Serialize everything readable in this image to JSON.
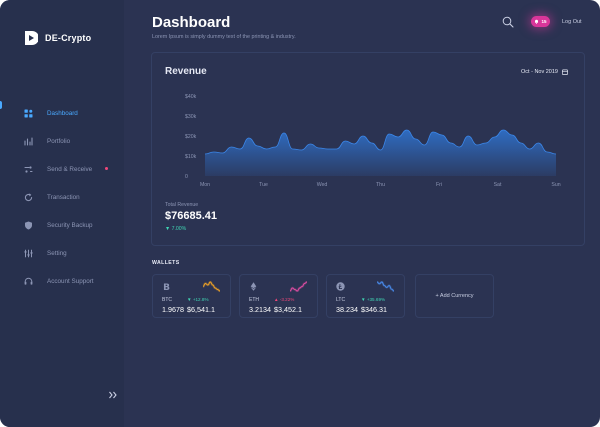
{
  "app": {
    "brand": "DE-Crypto"
  },
  "sidebar": {
    "items": [
      {
        "label": "Dashboard",
        "icon": "dashboard-icon",
        "active": true
      },
      {
        "label": "Portfolio",
        "icon": "portfolio-icon"
      },
      {
        "label": "Send & Receive",
        "icon": "send-receive-icon",
        "badge_dot": true
      },
      {
        "label": "Transaction",
        "icon": "transaction-icon"
      },
      {
        "label": "Security Backup",
        "icon": "shield-icon"
      },
      {
        "label": "Setting",
        "icon": "settings-sliders-icon"
      },
      {
        "label": "Account Support",
        "icon": "headset-icon"
      }
    ],
    "collapse_icon": "double-chevron-right-icon"
  },
  "header": {
    "title": "Dashboard",
    "subtitle": "Lorem Ipsum is simply dummy text of the printing & industry.",
    "notification_count": "15",
    "logout_label": "Log Out"
  },
  "revenue": {
    "title": "Revenue",
    "date_range": "Oct - Nov 2019",
    "total_label": "Total Revenue",
    "total_value": "$76685.41",
    "total_change": "▼ 7.00%"
  },
  "chart_data": {
    "type": "area",
    "title": "Revenue",
    "xlabel": "",
    "ylabel": "",
    "x_ticks": [
      "Mon",
      "Tue",
      "Wed",
      "Thu",
      "Fri",
      "Sat",
      "Sun"
    ],
    "y_ticks": [
      "0",
      "$10k",
      "$20k",
      "$30k",
      "$40k"
    ],
    "ylim": [
      0,
      40000
    ],
    "grid": false,
    "color": "#2f6fc7",
    "x": [
      0,
      0.15,
      0.3,
      0.45,
      0.6,
      0.75,
      0.9,
      1.05,
      1.2,
      1.35,
      1.5,
      1.65,
      1.8,
      1.95,
      2.1,
      2.25,
      2.4,
      2.55,
      2.7,
      2.85,
      3.0,
      3.15,
      3.3,
      3.45,
      3.6,
      3.75,
      3.9,
      4.05,
      4.2,
      4.35,
      4.5,
      4.65,
      4.8,
      4.95,
      5.1,
      5.25,
      5.4,
      5.55,
      5.7,
      5.85,
      6.0
    ],
    "values": [
      11000,
      12000,
      11500,
      14500,
      13500,
      19000,
      15000,
      13500,
      14500,
      21500,
      13500,
      13000,
      16000,
      14000,
      13500,
      13500,
      17500,
      16000,
      20000,
      16500,
      13000,
      21000,
      19500,
      23000,
      18500,
      15500,
      22000,
      20500,
      16500,
      14500,
      20000,
      15500,
      16500,
      19500,
      23000,
      20500,
      16500,
      13500,
      16500,
      12000,
      11000
    ]
  },
  "wallets": {
    "label": "WALLETS",
    "items": [
      {
        "symbol": "BTC",
        "coin_icon": "bitcoin-icon",
        "amount": "1.9678",
        "change": "▼ +12.8%",
        "value": "$6,541.1",
        "change_color": "#3fd6b4",
        "spark_color": "#f5a623",
        "spark": [
          6,
          8,
          7,
          9,
          7,
          5,
          4,
          3
        ]
      },
      {
        "symbol": "ETH",
        "coin_icon": "ethereum-icon",
        "amount": "3.2134",
        "change": "▲ -3.22%",
        "value": "$3,452.1",
        "change_color": "#f0477a",
        "spark_color": "#e64ea6",
        "spark": [
          3,
          5,
          4,
          3,
          5,
          6,
          8,
          9
        ]
      },
      {
        "symbol": "LTC",
        "coin_icon": "litecoin-icon",
        "amount": "38.234",
        "change": "▼ +35.69%",
        "value": "$346.31",
        "change_color": "#3fd6b4",
        "spark_color": "#4a8df0",
        "spark": [
          8,
          7,
          8,
          6,
          5,
          6,
          4,
          3
        ]
      }
    ],
    "add_label": "+ Add Currency"
  }
}
